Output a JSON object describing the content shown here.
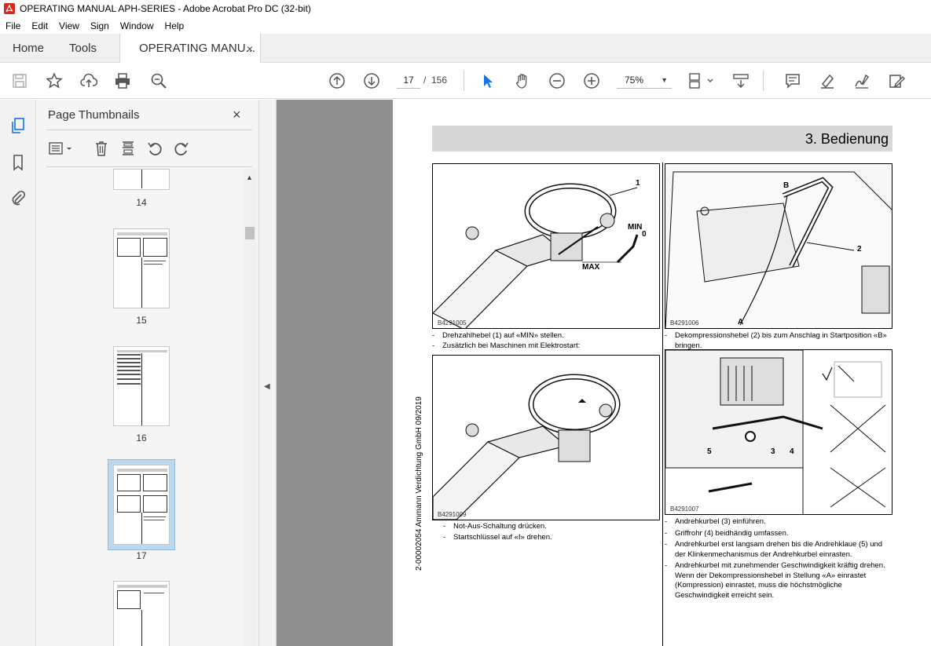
{
  "window": {
    "title": "OPERATING MANUAL APH-SERIES - Adobe Acrobat Pro DC (32-bit)"
  },
  "menu": [
    "File",
    "Edit",
    "View",
    "Sign",
    "Window",
    "Help"
  ],
  "tabs": {
    "home": "Home",
    "tools": "Tools",
    "document": "OPERATING MANU...",
    "close": "×"
  },
  "toolbar": {
    "current_page": "17",
    "page_separator": "/",
    "total_pages": "156",
    "zoom": "75%",
    "icons": [
      "save-icon",
      "bookmark-star-icon",
      "upload-icon",
      "print-icon",
      "search-zoom-icon",
      "page-up-icon",
      "page-down-icon",
      "select-cursor-icon",
      "hand-icon",
      "zoom-out-icon",
      "zoom-in-icon",
      "fit-page-icon",
      "scroll-mode-icon",
      "comment-icon",
      "highlight-icon",
      "sign-icon",
      "edit-icon"
    ]
  },
  "panel": {
    "title": "Page Thumbnails",
    "close": "×",
    "thumbnails": [
      {
        "label": "14",
        "selected": false
      },
      {
        "label": "15",
        "selected": false
      },
      {
        "label": "16",
        "selected": false
      },
      {
        "label": "17",
        "selected": true
      },
      {
        "label": "",
        "selected": false
      }
    ]
  },
  "document": {
    "section_title": "3. Bedienung",
    "side_text": "2-00002054   Ammann Verdichtung GmbH   09/2019",
    "figures": {
      "fig1": {
        "id": "B4291005",
        "labels": [
          "1",
          "MIN",
          "0",
          "MAX"
        ]
      },
      "fig2": {
        "id": "B4291006",
        "labels": [
          "B",
          "2",
          "A"
        ]
      },
      "fig3": {
        "id": "B4291009"
      },
      "fig4": {
        "id": "B4291007",
        "labels": [
          "5",
          "3",
          "4"
        ]
      }
    },
    "bullets_fig1": [
      "Drehzahlhebel (1) auf «MIN» stellen.",
      "Zusätzlich bei Maschinen mit Elektrostart:"
    ],
    "bullets_fig2": [
      "Dekompressionshebel (2) bis zum Anschlag in Startposition «B» bringen."
    ],
    "bullets_fig3": [
      "Not-Aus-Schaltung drücken.",
      "Startschlüssel auf «I» drehen."
    ],
    "bullets_fig4": [
      "Andrehkurbel (3) einführen.",
      "Griffrohr (4) beidhändig umfassen.",
      "Andrehkurbel erst langsam drehen bis die Andrehklaue (5) und der Klinkenmechanismus der Andrehkurbel einrasten.",
      "Andrehkurbel mit zunehmender Geschwindigkeit kräftig drehen. Wenn der Dekompressionshebel in Stellung «A» einrastet (Kompression) einrastet, muss die höchstmögliche Geschwindigkeit erreicht sein."
    ]
  }
}
